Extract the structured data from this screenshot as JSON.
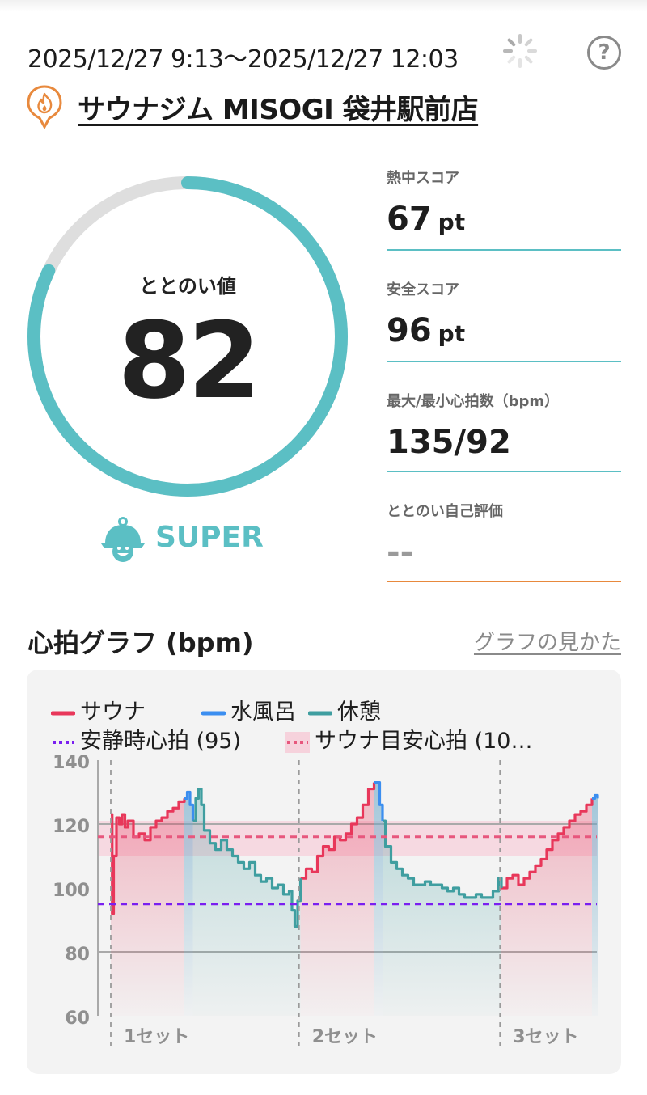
{
  "header": {
    "datetime": "2025/12/27 9:13～2025/12/27 12:03",
    "help_label": "?",
    "store_name": "サウナジム MISOGI 袋井駅前店"
  },
  "summary": {
    "ring_label": "ととのい値",
    "ring_value": "82",
    "ring_fraction": 0.82,
    "rank": "SUPER"
  },
  "scores": [
    {
      "caption": "熱中スコア",
      "value": "67",
      "unit": "pt"
    },
    {
      "caption": "安全スコア",
      "value": "96",
      "unit": "pt"
    },
    {
      "caption": "最大/最小心拍数（bpm）",
      "value": "135/92",
      "unit": ""
    },
    {
      "caption": "ととのい自己評価",
      "value": "--",
      "unit": ""
    }
  ],
  "graph": {
    "title": "心拍グラフ (bpm)",
    "help_link": "グラフの見かた"
  },
  "colors": {
    "sauna": "#e8375a",
    "cold_bath": "#3b8ef0",
    "rest": "#3f9ea0",
    "resting_hr": "#7a1ff0",
    "sauna_target": "#e7577d",
    "ring": "#5bbfc4",
    "ring_track": "#dedede",
    "accent_orange": "#e8893d"
  },
  "chart_data": {
    "type": "line",
    "xlabel": "",
    "ylabel": "",
    "ylim": [
      60,
      140
    ],
    "yticks": [
      140,
      120,
      100,
      80,
      60
    ],
    "legend": [
      {
        "name": "サウナ",
        "style": "solid",
        "color": "#e8375a"
      },
      {
        "name": "水風呂",
        "style": "solid",
        "color": "#3b8ef0"
      },
      {
        "name": "休憩",
        "style": "solid",
        "color": "#3f9ea0"
      },
      {
        "name": "安静時心拍 (95)",
        "style": "dotted",
        "color": "#7a1ff0"
      },
      {
        "name": "サウナ目安心拍 (10…",
        "style": "dotted-band",
        "color": "#e7577d"
      }
    ],
    "sets": [
      "1セット",
      "2セット",
      "3セット"
    ],
    "resting_hr": 95,
    "target_line": 116,
    "target_band": [
      110,
      121
    ],
    "series": [
      {
        "name": "サウナ",
        "segments": [
          [
            [
              0,
              123
            ],
            [
              0.5,
              92
            ],
            [
              1,
              110
            ],
            [
              2,
              122
            ],
            [
              3,
              120
            ],
            [
              4,
              123
            ],
            [
              5,
              119
            ],
            [
              6,
              121
            ],
            [
              8,
              116
            ],
            [
              10,
              117
            ],
            [
              12,
              115
            ],
            [
              14,
              119
            ],
            [
              16,
              121
            ],
            [
              18,
              122
            ],
            [
              20,
              124
            ],
            [
              22,
              125
            ],
            [
              24,
              127
            ],
            [
              26,
              128
            ]
          ],
          [
            [
              67,
              103
            ],
            [
              69,
              106
            ],
            [
              71,
              105
            ],
            [
              73,
              110
            ],
            [
              75,
              113
            ],
            [
              77,
              112
            ],
            [
              79,
              116
            ],
            [
              81,
              115
            ],
            [
              83,
              117
            ],
            [
              85,
              120
            ],
            [
              87,
              122
            ],
            [
              89,
              126
            ],
            [
              91,
              131
            ],
            [
              93,
              133
            ]
          ],
          [
            [
              138,
              100
            ],
            [
              140,
              103
            ],
            [
              142,
              104
            ],
            [
              144,
              101
            ],
            [
              146,
              103
            ],
            [
              148,
              105
            ],
            [
              150,
              107
            ],
            [
              152,
              109
            ],
            [
              154,
              112
            ],
            [
              156,
              115
            ],
            [
              158,
              117
            ],
            [
              160,
              119
            ],
            [
              162,
              121
            ],
            [
              164,
              123
            ],
            [
              166,
              124
            ],
            [
              168,
              126
            ],
            [
              170,
              128
            ]
          ]
        ]
      },
      {
        "name": "水風呂",
        "segments": [
          [
            [
              26,
              128
            ],
            [
              27,
              130
            ],
            [
              28,
              126
            ],
            [
              29,
              121
            ]
          ],
          [
            [
              93,
              133
            ],
            [
              94,
              133
            ],
            [
              95,
              126
            ],
            [
              96,
              121
            ]
          ],
          [
            [
              170,
              128
            ],
            [
              171,
              129
            ],
            [
              172,
              128
            ]
          ]
        ]
      },
      {
        "name": "休憩",
        "segments": [
          [
            [
              29,
              121
            ],
            [
              30,
              128
            ],
            [
              31,
              131
            ],
            [
              32,
              126
            ],
            [
              33,
              118
            ],
            [
              35,
              114
            ],
            [
              37,
              112
            ],
            [
              39,
              115
            ],
            [
              41,
              112
            ],
            [
              43,
              110
            ],
            [
              45,
              108
            ],
            [
              47,
              106
            ],
            [
              49,
              108
            ],
            [
              51,
              104
            ],
            [
              53,
              102
            ],
            [
              55,
              103
            ],
            [
              57,
              100
            ],
            [
              59,
              101
            ],
            [
              61,
              98
            ],
            [
              63,
              99
            ],
            [
              64,
              93
            ],
            [
              65,
              88
            ],
            [
              66,
              96
            ],
            [
              67,
              103
            ]
          ],
          [
            [
              96,
              121
            ],
            [
              97,
              113
            ],
            [
              99,
              108
            ],
            [
              101,
              106
            ],
            [
              103,
              104
            ],
            [
              105,
              103
            ],
            [
              107,
              101
            ],
            [
              109,
              101
            ],
            [
              111,
              102
            ],
            [
              113,
              101
            ],
            [
              115,
              101
            ],
            [
              117,
              100
            ],
            [
              119,
              99
            ],
            [
              121,
              100
            ],
            [
              123,
              98
            ],
            [
              125,
              97
            ],
            [
              127,
              97
            ],
            [
              129,
              98
            ],
            [
              131,
              97
            ],
            [
              133,
              97
            ],
            [
              135,
              99
            ],
            [
              137,
              103
            ],
            [
              138,
              100
            ]
          ]
        ]
      }
    ]
  }
}
